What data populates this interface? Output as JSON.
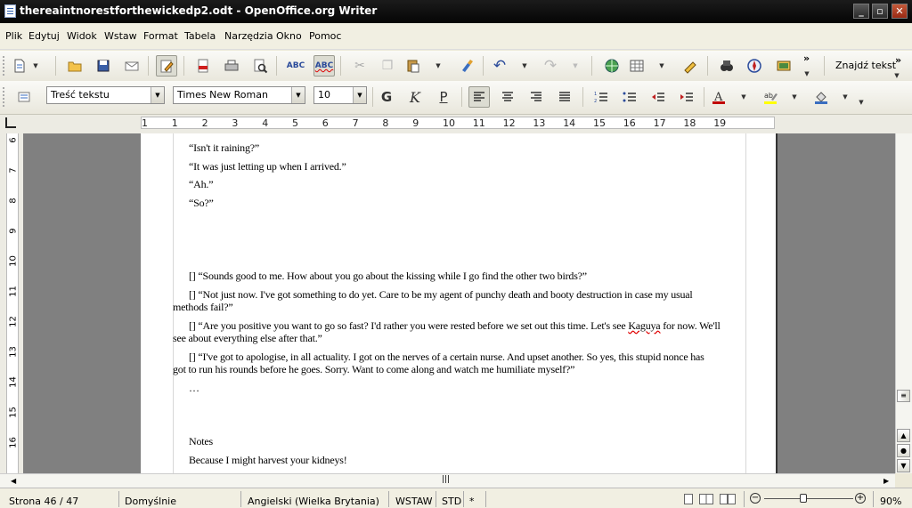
{
  "window": {
    "title": "thereaintnorestforthewickedp2.odt - OpenOffice.org Writer"
  },
  "menu": [
    "Plik",
    "Edytuj",
    "Widok",
    "Wstaw",
    "Format",
    "Tabela",
    "Narzędzia",
    "Okno",
    "Pomoc"
  ],
  "toolbar": {
    "find_label": "Znajdź tekst",
    "paragraph_style": "Treść tekstu",
    "font_name": "Times New Roman",
    "font_size": "10"
  },
  "ruler": {
    "numbers": [
      "1",
      "1",
      "2",
      "3",
      "4",
      "5",
      "6",
      "7",
      "8",
      "9",
      "10",
      "11",
      "12",
      "13",
      "14",
      "15",
      "16",
      "17",
      "18",
      "19"
    ],
    "vertical_numbers": [
      "6",
      "7",
      "8",
      "9",
      "10",
      "11",
      "12",
      "13",
      "14",
      "15",
      "16"
    ]
  },
  "document": {
    "paragraphs": [
      "“Isn't it raining?”",
      "“It was just letting up when I arrived.”",
      "“Ah.”",
      "“So?”",
      "[] “Sounds good to me. How about you go about the kissing while I go find the other two birds?”",
      "[] “Not just now. I've got something to do yet. Care to be my agent of punchy death and booty destruction in case my usual",
      "methods fail?”",
      "[] “Are you positive you want to go so fast? I'd rather you were rested before we set out this time. Let's see ",
      "Kaguya",
      " for now. We'll",
      "see about everything else after that.”",
      "[] “I've got to apologise, in all actuality. I got on the nerves of a certain nurse. And upset another. So yes, this stupid nonce has",
      "got to run his rounds before he goes. Sorry. Want to come along and watch me humiliate myself?”",
      "…",
      "Notes",
      "Because I might harvest your kidneys!"
    ]
  },
  "status": {
    "page": "Strona  46 / 47",
    "style": "Domyślnie",
    "language": "Angielski (Wielka Brytania)",
    "insert_mode": "WSTAW",
    "selection_mode": "STD",
    "modified": "*",
    "zoom": "90%",
    "zoom_level": 0.9
  },
  "colors": {
    "font_color": "#c00000",
    "highlight": "#ffff00",
    "spell_error": "#e00000"
  }
}
